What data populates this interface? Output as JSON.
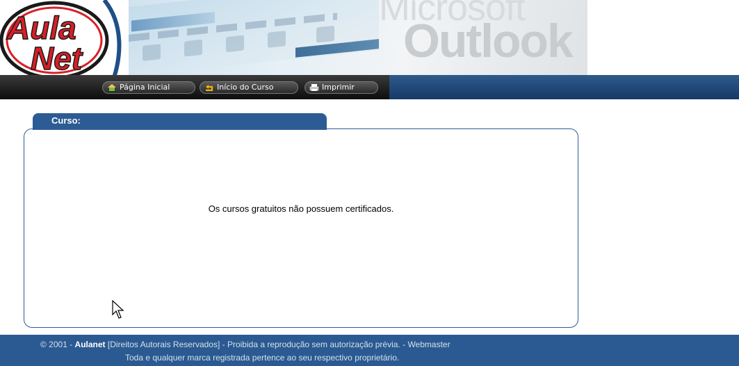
{
  "logo": {
    "line1": "Aula",
    "line2": "Net"
  },
  "banner": {
    "word1": "Microsoft",
    "word2": "Outlook Ex"
  },
  "nav": {
    "home_label": "Página Inicial",
    "course_start_label": "Início do Curso",
    "print_label": "Imprimir"
  },
  "panel": {
    "tab_title": "Curso:",
    "message": "Os cursos gratuitos não possuem certificados."
  },
  "footer": {
    "copyright": "© 2001 - ",
    "brand": "Aulanet",
    "rights": " [Direitos Autorais Reservados] - Proibida a reprodução sem autorização prévia. - ",
    "webmaster": "Webmaster",
    "trademark": "Toda e qualquer marca registrada pertence ao seu respectivo proprietário."
  },
  "colors": {
    "brand_blue": "#2d5b94",
    "logo_red": "#d81f26",
    "navbar_dark": "#1a1a1a"
  }
}
